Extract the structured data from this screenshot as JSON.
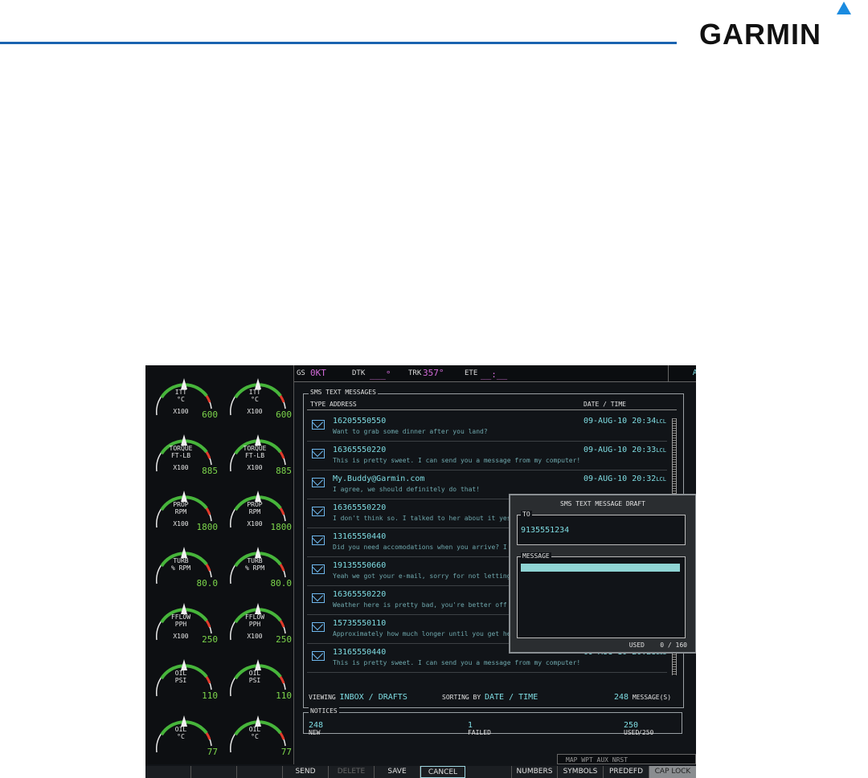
{
  "brand": "GARMIN",
  "colors": {
    "accent_cyan": "#7fdde3",
    "magenta": "#d26ad8",
    "gauge_green": "#7cd64b",
    "header_blue": "#1a63b0"
  },
  "topbar": {
    "gs_label": "GS",
    "gs_value": "0KT",
    "dtk_label": "DTK",
    "dtk_value": "___°",
    "trk_label": "TRK",
    "trk_value": "357°",
    "ete_label": "ETE",
    "ete_value": "__:__",
    "page_title": "AUX - TEXT MESSAGING"
  },
  "gauges": {
    "left": [
      {
        "l1": "ITT",
        "l2": "°C",
        "l3": "X100",
        "value": "600"
      },
      {
        "l1": "TORQUE",
        "l2": "FT-LB",
        "l3": "X100",
        "value": "885"
      },
      {
        "l1": "PROP",
        "l2": "RPM",
        "l3": "X100",
        "value": "1800"
      },
      {
        "l1": "TURB",
        "l2": "% RPM",
        "l3": "",
        "value": "80.0"
      },
      {
        "l1": "FFLOW",
        "l2": "PPH",
        "l3": "X100",
        "value": "250"
      },
      {
        "l1": "OIL",
        "l2": "PSI",
        "l3": "",
        "value": "110"
      },
      {
        "l1": "OIL",
        "l2": "°C",
        "l3": "",
        "value": "77"
      }
    ],
    "right": [
      {
        "l1": "ITT",
        "l2": "°C",
        "l3": "X100",
        "value": "600"
      },
      {
        "l1": "TORQUE",
        "l2": "FT-LB",
        "l3": "X100",
        "value": "885"
      },
      {
        "l1": "PROP",
        "l2": "RPM",
        "l3": "X100",
        "value": "1800"
      },
      {
        "l1": "TURB",
        "l2": "% RPM",
        "l3": "",
        "value": "80.0"
      },
      {
        "l1": "FFLOW",
        "l2": "PPH",
        "l3": "X100",
        "value": "250"
      },
      {
        "l1": "OIL",
        "l2": "PSI",
        "l3": "",
        "value": "110"
      },
      {
        "l1": "OIL",
        "l2": "°C",
        "l3": "",
        "value": "77"
      }
    ]
  },
  "messages_panel": {
    "title": "SMS TEXT MESSAGES",
    "col_type": "TYPE",
    "col_address": "ADDRESS",
    "col_datetime": "DATE / TIME",
    "rows": [
      {
        "address": "16205550550",
        "text": "Want to grab some dinner after you land?",
        "date": "09-AUG-10",
        "time": "20:34",
        "tz": "LCL"
      },
      {
        "address": "16365550220",
        "text": "This is pretty sweet. I can send you a message from my computer!",
        "date": "09-AUG-10",
        "time": "20:33",
        "tz": "LCL"
      },
      {
        "address": "My.Buddy@Garmin.com",
        "text": "I agree, we should definitely do that!",
        "date": "09-AUG-10",
        "time": "20:32",
        "tz": "LCL"
      },
      {
        "address": "16365550220",
        "text": "I don't think so. I talked to her about it yeste",
        "date": "",
        "time": "",
        "tz": ""
      },
      {
        "address": "13165550440",
        "text": "Did you need accomodations when you arrive? I f",
        "date": "",
        "time": "",
        "tz": ""
      },
      {
        "address": "19135550660",
        "text": "Yeah we got your e-mail, sorry for not letting y",
        "date": "",
        "time": "",
        "tz": ""
      },
      {
        "address": "16365550220",
        "text": "Weather here is pretty bad, you're better off go",
        "date": "",
        "time": "",
        "tz": ""
      },
      {
        "address": "15735550110",
        "text": "Approximately how much longer until you get here",
        "date": "",
        "time": "",
        "tz": ""
      },
      {
        "address": "13165550440",
        "text": "This is pretty sweet. I can send you a message from my computer!",
        "date": "09-AUG-10",
        "time": "20:28",
        "tz": "LCL"
      }
    ],
    "viewing_label": "VIEWING",
    "viewing_value": "INBOX / DRAFTS",
    "sorting_label": "SORTING BY",
    "sorting_value": "DATE / TIME",
    "count": "248",
    "count_label": "MESSAGE(S)"
  },
  "draft": {
    "title": "SMS TEXT MESSAGE DRAFT",
    "to_label": "TO",
    "to_value": "9135551234",
    "message_label": "MESSAGE",
    "used_label": "USED",
    "used_value": "0",
    "used_max": "/ 160"
  },
  "notices": {
    "title": "NOTICES",
    "new_label": "NEW",
    "new_value": "248",
    "failed_label": "FAILED",
    "failed_value": "1",
    "used_label": "USED",
    "used_value": "250",
    "used_max": "/250"
  },
  "nav_bar": "MAP WPT AUX NRST",
  "softkeys": [
    "SEND",
    "DELETE",
    "SAVE",
    "CANCEL",
    "NUMBERS",
    "SYMBOLS",
    "PREDEFD",
    "CAP LOCK"
  ]
}
